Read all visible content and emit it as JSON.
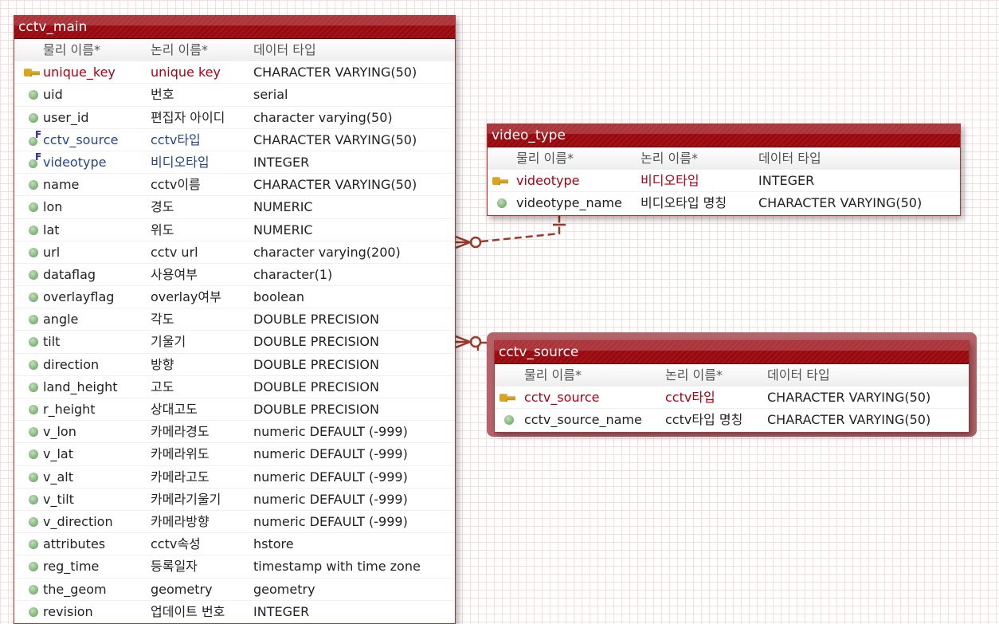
{
  "column_headers": [
    "물리 이름*",
    "논리 이름*",
    "데이터 타입"
  ],
  "tables": {
    "cctv_main": {
      "title": "cctv_main",
      "rows": [
        [
          "pk",
          "unique_key",
          "unique key",
          "CHARACTER  VARYING(50)"
        ],
        [
          "col",
          "uid",
          "번호",
          "serial"
        ],
        [
          "col",
          "user_id",
          "편집자 아이디",
          "character varying(50)"
        ],
        [
          "fk",
          "cctv_source",
          "cctv타입",
          "CHARACTER  VARYING(50)"
        ],
        [
          "fk",
          "videotype",
          "비디오타입",
          "INTEGER"
        ],
        [
          "col",
          "name",
          "cctv이름",
          "CHARACTER  VARYING(50)"
        ],
        [
          "col",
          "lon",
          "경도",
          "NUMERIC"
        ],
        [
          "col",
          "lat",
          "위도",
          "NUMERIC"
        ],
        [
          "col",
          "url",
          "cctv url",
          "character varying(200)"
        ],
        [
          "col",
          "dataflag",
          "사용여부",
          "character(1)"
        ],
        [
          "col",
          "overlayflag",
          "overlay여부",
          "boolean"
        ],
        [
          "col",
          "angle",
          "각도",
          "DOUBLE  PRECISION"
        ],
        [
          "col",
          "tilt",
          "기울기",
          "DOUBLE  PRECISION"
        ],
        [
          "col",
          "direction",
          "방향",
          "DOUBLE  PRECISION"
        ],
        [
          "col",
          "land_height",
          "고도",
          "DOUBLE  PRECISION"
        ],
        [
          "col",
          "r_height",
          "상대고도",
          "DOUBLE  PRECISION"
        ],
        [
          "col",
          "v_lon",
          "카메라경도",
          "numeric  DEFAULT  (-999)"
        ],
        [
          "col",
          "v_lat",
          "카메라위도",
          "numeric  DEFAULT  (-999)"
        ],
        [
          "col",
          "v_alt",
          "카메라고도",
          "numeric  DEFAULT  (-999)"
        ],
        [
          "col",
          "v_tilt",
          "카메라기울기",
          "numeric  DEFAULT  (-999)"
        ],
        [
          "col",
          "v_direction",
          "카메라방향",
          "numeric  DEFAULT  (-999)"
        ],
        [
          "col",
          "attributes",
          "cctv속성",
          "hstore"
        ],
        [
          "col",
          "reg_time",
          "등록일자",
          "timestamp with time zone"
        ],
        [
          "col",
          "the_geom",
          "geometry",
          "geometry"
        ],
        [
          "col",
          "revision",
          "업데이트 번호",
          "INTEGER"
        ]
      ]
    },
    "video_type": {
      "title": "video_type",
      "rows": [
        [
          "pk",
          "videotype",
          "비디오타입",
          "INTEGER"
        ],
        [
          "col",
          "videotype_name",
          "비디오타입 명칭",
          "CHARACTER  VARYING(50)"
        ]
      ]
    },
    "cctv_source": {
      "title": "cctv_source",
      "selected": true,
      "rows": [
        [
          "pk",
          "cctv_source",
          "cctv타입",
          "CHARACTER  VARYING(50)"
        ],
        [
          "col",
          "cctv_source_name",
          "cctv타입 명칭",
          "CHARACTER  VARYING(50)"
        ]
      ]
    }
  },
  "relationships": [
    {
      "from": "video_type",
      "to": "cctv_main",
      "style": "dashed",
      "cardinality": "one-to-zero-or-many"
    },
    {
      "from": "cctv_source",
      "to": "cctv_main",
      "style": "solid",
      "cardinality": "one-to-zero-or-many"
    }
  ],
  "colors": {
    "header": "#a31016",
    "pk_text": "#b00010",
    "fk_text": "#24468a",
    "relation": "#9a3a2a"
  }
}
